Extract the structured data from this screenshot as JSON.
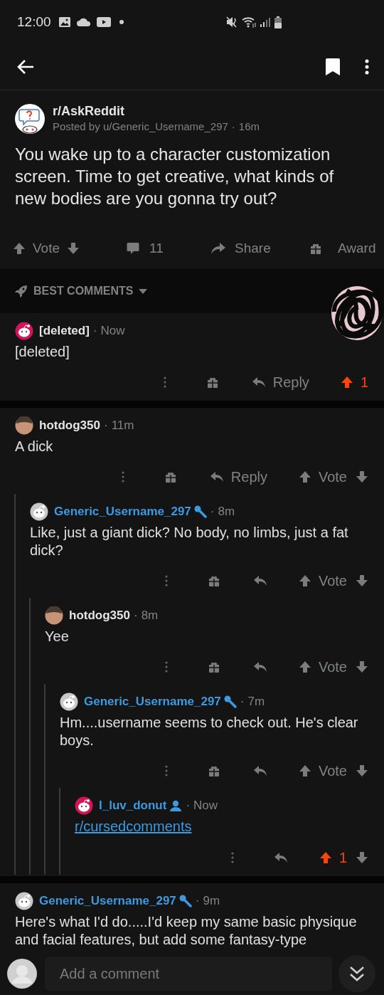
{
  "status_bar": {
    "time": "12:00"
  },
  "post": {
    "subreddit": "r/AskReddit",
    "posted_by": "Posted by u/Generic_Username_297",
    "separator": "·",
    "time": "16m",
    "title": "You wake up to a character customization screen. Time to get creative, what kinds of new bodies are you gonna try out?",
    "vote_label": "Vote",
    "comment_count": "11",
    "share_label": "Share",
    "award_label": "Award"
  },
  "sort": {
    "label": "BEST COMMENTS"
  },
  "comments": [
    {
      "kind": "plain",
      "author": "[deleted]",
      "avatar": {
        "kind": "snoo",
        "color": "#d4145a"
      },
      "separator": "·",
      "time": "Now",
      "body": "[deleted]",
      "actions": {
        "award": true,
        "reply_label": "Reply",
        "score": "1",
        "upvoted": true,
        "downvote": false
      }
    },
    {
      "kind": "plain",
      "author": "hotdog350",
      "avatar": {
        "kind": "person"
      },
      "separator": "·",
      "time": "11m",
      "body": "A dick",
      "actions": {
        "award": true,
        "reply_label": "Reply",
        "score": "Vote",
        "upvoted": false,
        "downvote": true
      },
      "children": [
        {
          "kind": "op",
          "author": "Generic_Username_297",
          "avatar": {
            "kind": "snoo",
            "color": "#c8c8c8"
          },
          "separator": "·",
          "time": "8m",
          "body": "Like, just a giant dick? No body, no limbs, just a fat dick?",
          "actions": {
            "award": true,
            "score": "Vote",
            "upvoted": false,
            "downvote": true
          },
          "children": [
            {
              "kind": "plain",
              "author": "hotdog350",
              "avatar": {
                "kind": "person"
              },
              "separator": "·",
              "time": "8m",
              "body": "Yee",
              "actions": {
                "award": true,
                "score": "Vote",
                "upvoted": false,
                "downvote": true
              },
              "children": [
                {
                  "kind": "op",
                  "author": "Generic_Username_297",
                  "avatar": {
                    "kind": "snoo",
                    "color": "#c8c8c8"
                  },
                  "separator": "·",
                  "time": "7m",
                  "body": "Hm....username seems to check out. He's clear boys.",
                  "actions": {
                    "award": true,
                    "score": "Vote",
                    "upvoted": false,
                    "downvote": true
                  },
                  "children": [
                    {
                      "kind": "member",
                      "author": "I_luv_donut",
                      "avatar": {
                        "kind": "snoo",
                        "color": "#d4145a"
                      },
                      "separator": "·",
                      "time": "Now",
                      "link": "r/cursedcomments",
                      "actions": {
                        "award": false,
                        "score": "1",
                        "upvoted": true,
                        "downvote": true
                      }
                    }
                  ]
                }
              ]
            }
          ]
        }
      ]
    },
    {
      "kind": "op",
      "author": "Generic_Username_297",
      "avatar": {
        "kind": "snoo",
        "color": "#c8c8c8"
      },
      "separator": "·",
      "time": "9m",
      "body": "Here's what I'd do.....I'd keep my same basic physique and facial features, but add some fantasy-type"
    }
  ],
  "composer": {
    "placeholder": "Add a comment"
  }
}
